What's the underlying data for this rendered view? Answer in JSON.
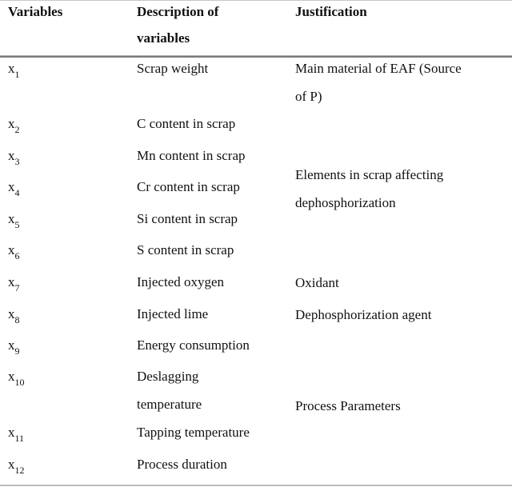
{
  "table": {
    "headers": {
      "variables": "Variables",
      "description_line1": "Description of",
      "description_line2": "variables",
      "justification": "Justification"
    },
    "rows": [
      {
        "var": "x",
        "sub": "1",
        "desc": "Scrap weight"
      },
      {
        "var": "x",
        "sub": "2",
        "desc": "C content in scrap"
      },
      {
        "var": "x",
        "sub": "3",
        "desc": "Mn content in scrap"
      },
      {
        "var": "x",
        "sub": "4",
        "desc": "Cr content in scrap"
      },
      {
        "var": "x",
        "sub": "5",
        "desc": "Si content in scrap"
      },
      {
        "var": "x",
        "sub": "6",
        "desc": "S content in scrap"
      },
      {
        "var": "x",
        "sub": "7",
        "desc": "Injected oxygen"
      },
      {
        "var": "x",
        "sub": "8",
        "desc": "Injected lime"
      },
      {
        "var": "x",
        "sub": "9",
        "desc": "Energy consumption"
      },
      {
        "var": "x",
        "sub": "10",
        "desc_line1": "Deslagging",
        "desc_line2": "temperature"
      },
      {
        "var": "x",
        "sub": "11",
        "desc": "Tapping temperature"
      },
      {
        "var": "x",
        "sub": "12",
        "desc": "Process duration"
      }
    ],
    "justifications": [
      {
        "line1": "Main material of EAF (Source",
        "line2": "of P)",
        "rows": "x1"
      },
      {
        "line1": "Elements in scrap affecting",
        "line2": "dephosphorization",
        "rows": "x2-x6"
      },
      {
        "line1": "Oxidant",
        "rows": "x7"
      },
      {
        "line1": "Dephosphorization agent",
        "rows": "x8"
      },
      {
        "line1": "Process Parameters",
        "rows": "x9-x12"
      }
    ]
  }
}
